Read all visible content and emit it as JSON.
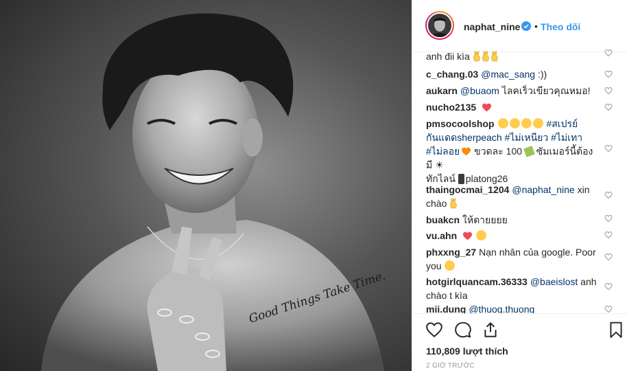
{
  "post": {
    "photo_tattoo": "Good Things Take Time."
  },
  "header": {
    "username": "naphat_nine",
    "separator": "•",
    "follow_label": "Theo dõi"
  },
  "comments": [
    {
      "user": "",
      "text": "anh đii kìa"
    },
    {
      "user": "c_chang.03",
      "mention": "@mac_sang",
      "text": " :))"
    },
    {
      "user": "aukarn",
      "mention": "@buaom",
      "text": " ไลคเร็วเขียวคุณหมอ!"
    },
    {
      "user": "nucho2135",
      "text": ""
    },
    {
      "user": "pmsocoolshop",
      "tag1": "#สเปรย์",
      "line2_tag": "กันแดดsherpeach",
      "tag2": " #ไม่เหนียว",
      "tag3": " #ไม่เทา",
      "tag4": "#ไม่ลอย",
      "text_a": " ขวดละ 100 ",
      "text_b": " ซัมเมอร์นี้ต้อง",
      "line4": "มี ☀",
      "line5_a": "ทักไลน์ ",
      "line5_b": "platong26"
    },
    {
      "user": "thaingocmai_1204",
      "mention": "@naphat_nine",
      "text": " xin",
      "line2": "chào"
    },
    {
      "user": "buakcn",
      "text": "ให้ตายยยย"
    },
    {
      "user": "vu.ahn",
      "text": ""
    },
    {
      "user": "phxxng_27",
      "text": "Nạn nhân của google. Poor",
      "line2": "you"
    },
    {
      "user": "hotgirlquancam.36333",
      "mention": "@baeislost",
      "text": " anh",
      "line2": "chào t kìa"
    },
    {
      "user": "mii.dung",
      "mention": "@thuog.thuong",
      "text": ""
    }
  ],
  "footer": {
    "likes": "110,809 lượt thích",
    "time": "2 GIỜ TRƯỚC"
  },
  "icons": {
    "like": "heart-icon",
    "comment": "comment-icon",
    "share": "share-icon",
    "save": "bookmark-icon",
    "verified": "verified-badge-icon"
  },
  "colors": {
    "link": "#3897f0",
    "mention": "#003569",
    "heart_red": "#ed4956",
    "text": "#262626"
  }
}
